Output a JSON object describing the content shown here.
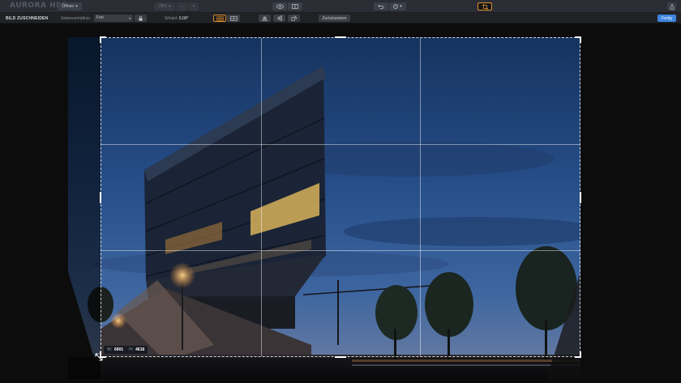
{
  "app": {
    "logo_text": "AURORA HDR"
  },
  "topbar": {
    "open_label": "Öffnen",
    "zoom_label": "25%",
    "zoom_out": "−",
    "zoom_in": "+",
    "history_caret": "▾"
  },
  "cropbar": {
    "title": "BILD ZUSCHNEIDEN",
    "aspect_label": "Seitenverhältnis:",
    "aspect_value": "Frei",
    "angle_label": "Winkel:",
    "angle_value": "0.00°",
    "reset_label": "Zurücksetzen",
    "done_label": "Fertig"
  },
  "crop": {
    "w_label": "W:",
    "w_value": "6901",
    "h_label": "H:",
    "h_value": "4616"
  },
  "colors": {
    "accent_orange": "#e0902e",
    "done_blue": "#3d86e0",
    "toolbar_bg": "#2a2d33"
  }
}
